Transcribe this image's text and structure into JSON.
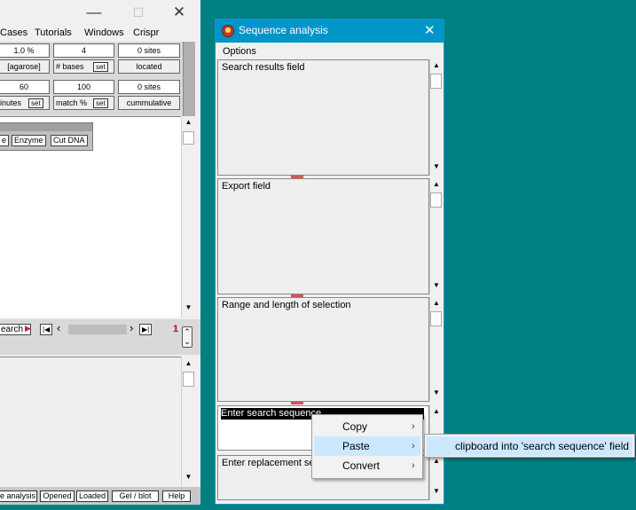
{
  "left_window": {
    "title_buttons": {
      "minimize": "—",
      "maximize": "☐",
      "close": "✕"
    },
    "menu": [
      "Cases",
      "Tutorials",
      "Windows",
      "Crispr"
    ],
    "params": {
      "r1": {
        "a": "1.0 %",
        "b": "4",
        "c": "0  sites"
      },
      "r2": {
        "a": "[agarose]",
        "b": "# bases",
        "b_set": "set",
        "c": "located"
      },
      "r3": {
        "a": "60",
        "b": "100",
        "c": "0  sites"
      },
      "r4": {
        "a": "inutes",
        "a_set": "set",
        "b": "match %",
        "b_set": "set",
        "c": "cummulative"
      }
    },
    "toolbar": {
      "b1": "e",
      "b2": "Enzyme",
      "b3": "Cut DNA"
    },
    "nav": {
      "search": "earch",
      "first": "|◀",
      "prev": "‹",
      "next": "›",
      "last": "▶|",
      "count": "1"
    },
    "status": {
      "s1": "e analysis",
      "s2": "Opened",
      "s3": "Loaded",
      "s4": "Gel / blot",
      "s5": "Help"
    }
  },
  "seq_window": {
    "title": "Sequence analysis",
    "close": "✕",
    "menu_options": "Options",
    "panes": {
      "search_results": "Search results field",
      "export": "Export field",
      "range": "Range and length of selection",
      "search_seq": "Enter search sequence",
      "replacement": "Enter replacement se"
    }
  },
  "context_menu": {
    "items": [
      "Copy",
      "Paste",
      "Convert"
    ],
    "submenu_item": "clipboard into 'search sequence' field"
  },
  "colors": {
    "desktop": "#008080",
    "title_bar": "#0095c8",
    "highlight": "#cce8ff"
  }
}
